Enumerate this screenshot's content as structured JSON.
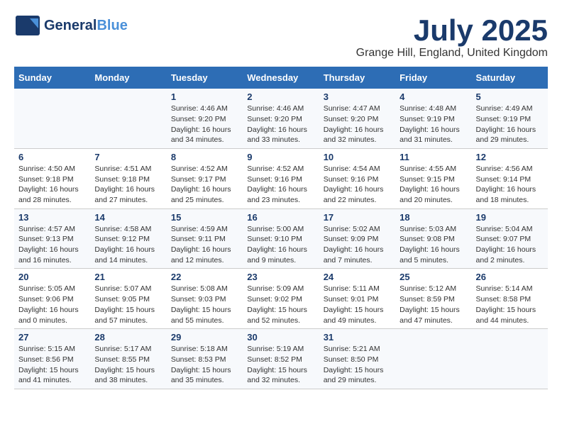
{
  "header": {
    "logo_general": "General",
    "logo_blue": "Blue",
    "title": "July 2025",
    "subtitle": "Grange Hill, England, United Kingdom"
  },
  "weekdays": [
    "Sunday",
    "Monday",
    "Tuesday",
    "Wednesday",
    "Thursday",
    "Friday",
    "Saturday"
  ],
  "weeks": [
    [
      {
        "day": "",
        "sunrise": "",
        "sunset": "",
        "daylight": ""
      },
      {
        "day": "",
        "sunrise": "",
        "sunset": "",
        "daylight": ""
      },
      {
        "day": "1",
        "sunrise": "Sunrise: 4:46 AM",
        "sunset": "Sunset: 9:20 PM",
        "daylight": "Daylight: 16 hours and 34 minutes."
      },
      {
        "day": "2",
        "sunrise": "Sunrise: 4:46 AM",
        "sunset": "Sunset: 9:20 PM",
        "daylight": "Daylight: 16 hours and 33 minutes."
      },
      {
        "day": "3",
        "sunrise": "Sunrise: 4:47 AM",
        "sunset": "Sunset: 9:20 PM",
        "daylight": "Daylight: 16 hours and 32 minutes."
      },
      {
        "day": "4",
        "sunrise": "Sunrise: 4:48 AM",
        "sunset": "Sunset: 9:19 PM",
        "daylight": "Daylight: 16 hours and 31 minutes."
      },
      {
        "day": "5",
        "sunrise": "Sunrise: 4:49 AM",
        "sunset": "Sunset: 9:19 PM",
        "daylight": "Daylight: 16 hours and 29 minutes."
      }
    ],
    [
      {
        "day": "6",
        "sunrise": "Sunrise: 4:50 AM",
        "sunset": "Sunset: 9:18 PM",
        "daylight": "Daylight: 16 hours and 28 minutes."
      },
      {
        "day": "7",
        "sunrise": "Sunrise: 4:51 AM",
        "sunset": "Sunset: 9:18 PM",
        "daylight": "Daylight: 16 hours and 27 minutes."
      },
      {
        "day": "8",
        "sunrise": "Sunrise: 4:52 AM",
        "sunset": "Sunset: 9:17 PM",
        "daylight": "Daylight: 16 hours and 25 minutes."
      },
      {
        "day": "9",
        "sunrise": "Sunrise: 4:52 AM",
        "sunset": "Sunset: 9:16 PM",
        "daylight": "Daylight: 16 hours and 23 minutes."
      },
      {
        "day": "10",
        "sunrise": "Sunrise: 4:54 AM",
        "sunset": "Sunset: 9:16 PM",
        "daylight": "Daylight: 16 hours and 22 minutes."
      },
      {
        "day": "11",
        "sunrise": "Sunrise: 4:55 AM",
        "sunset": "Sunset: 9:15 PM",
        "daylight": "Daylight: 16 hours and 20 minutes."
      },
      {
        "day": "12",
        "sunrise": "Sunrise: 4:56 AM",
        "sunset": "Sunset: 9:14 PM",
        "daylight": "Daylight: 16 hours and 18 minutes."
      }
    ],
    [
      {
        "day": "13",
        "sunrise": "Sunrise: 4:57 AM",
        "sunset": "Sunset: 9:13 PM",
        "daylight": "Daylight: 16 hours and 16 minutes."
      },
      {
        "day": "14",
        "sunrise": "Sunrise: 4:58 AM",
        "sunset": "Sunset: 9:12 PM",
        "daylight": "Daylight: 16 hours and 14 minutes."
      },
      {
        "day": "15",
        "sunrise": "Sunrise: 4:59 AM",
        "sunset": "Sunset: 9:11 PM",
        "daylight": "Daylight: 16 hours and 12 minutes."
      },
      {
        "day": "16",
        "sunrise": "Sunrise: 5:00 AM",
        "sunset": "Sunset: 9:10 PM",
        "daylight": "Daylight: 16 hours and 9 minutes."
      },
      {
        "day": "17",
        "sunrise": "Sunrise: 5:02 AM",
        "sunset": "Sunset: 9:09 PM",
        "daylight": "Daylight: 16 hours and 7 minutes."
      },
      {
        "day": "18",
        "sunrise": "Sunrise: 5:03 AM",
        "sunset": "Sunset: 9:08 PM",
        "daylight": "Daylight: 16 hours and 5 minutes."
      },
      {
        "day": "19",
        "sunrise": "Sunrise: 5:04 AM",
        "sunset": "Sunset: 9:07 PM",
        "daylight": "Daylight: 16 hours and 2 minutes."
      }
    ],
    [
      {
        "day": "20",
        "sunrise": "Sunrise: 5:05 AM",
        "sunset": "Sunset: 9:06 PM",
        "daylight": "Daylight: 16 hours and 0 minutes."
      },
      {
        "day": "21",
        "sunrise": "Sunrise: 5:07 AM",
        "sunset": "Sunset: 9:05 PM",
        "daylight": "Daylight: 15 hours and 57 minutes."
      },
      {
        "day": "22",
        "sunrise": "Sunrise: 5:08 AM",
        "sunset": "Sunset: 9:03 PM",
        "daylight": "Daylight: 15 hours and 55 minutes."
      },
      {
        "day": "23",
        "sunrise": "Sunrise: 5:09 AM",
        "sunset": "Sunset: 9:02 PM",
        "daylight": "Daylight: 15 hours and 52 minutes."
      },
      {
        "day": "24",
        "sunrise": "Sunrise: 5:11 AM",
        "sunset": "Sunset: 9:01 PM",
        "daylight": "Daylight: 15 hours and 49 minutes."
      },
      {
        "day": "25",
        "sunrise": "Sunrise: 5:12 AM",
        "sunset": "Sunset: 8:59 PM",
        "daylight": "Daylight: 15 hours and 47 minutes."
      },
      {
        "day": "26",
        "sunrise": "Sunrise: 5:14 AM",
        "sunset": "Sunset: 8:58 PM",
        "daylight": "Daylight: 15 hours and 44 minutes."
      }
    ],
    [
      {
        "day": "27",
        "sunrise": "Sunrise: 5:15 AM",
        "sunset": "Sunset: 8:56 PM",
        "daylight": "Daylight: 15 hours and 41 minutes."
      },
      {
        "day": "28",
        "sunrise": "Sunrise: 5:17 AM",
        "sunset": "Sunset: 8:55 PM",
        "daylight": "Daylight: 15 hours and 38 minutes."
      },
      {
        "day": "29",
        "sunrise": "Sunrise: 5:18 AM",
        "sunset": "Sunset: 8:53 PM",
        "daylight": "Daylight: 15 hours and 35 minutes."
      },
      {
        "day": "30",
        "sunrise": "Sunrise: 5:19 AM",
        "sunset": "Sunset: 8:52 PM",
        "daylight": "Daylight: 15 hours and 32 minutes."
      },
      {
        "day": "31",
        "sunrise": "Sunrise: 5:21 AM",
        "sunset": "Sunset: 8:50 PM",
        "daylight": "Daylight: 15 hours and 29 minutes."
      },
      {
        "day": "",
        "sunrise": "",
        "sunset": "",
        "daylight": ""
      },
      {
        "day": "",
        "sunrise": "",
        "sunset": "",
        "daylight": ""
      }
    ]
  ]
}
